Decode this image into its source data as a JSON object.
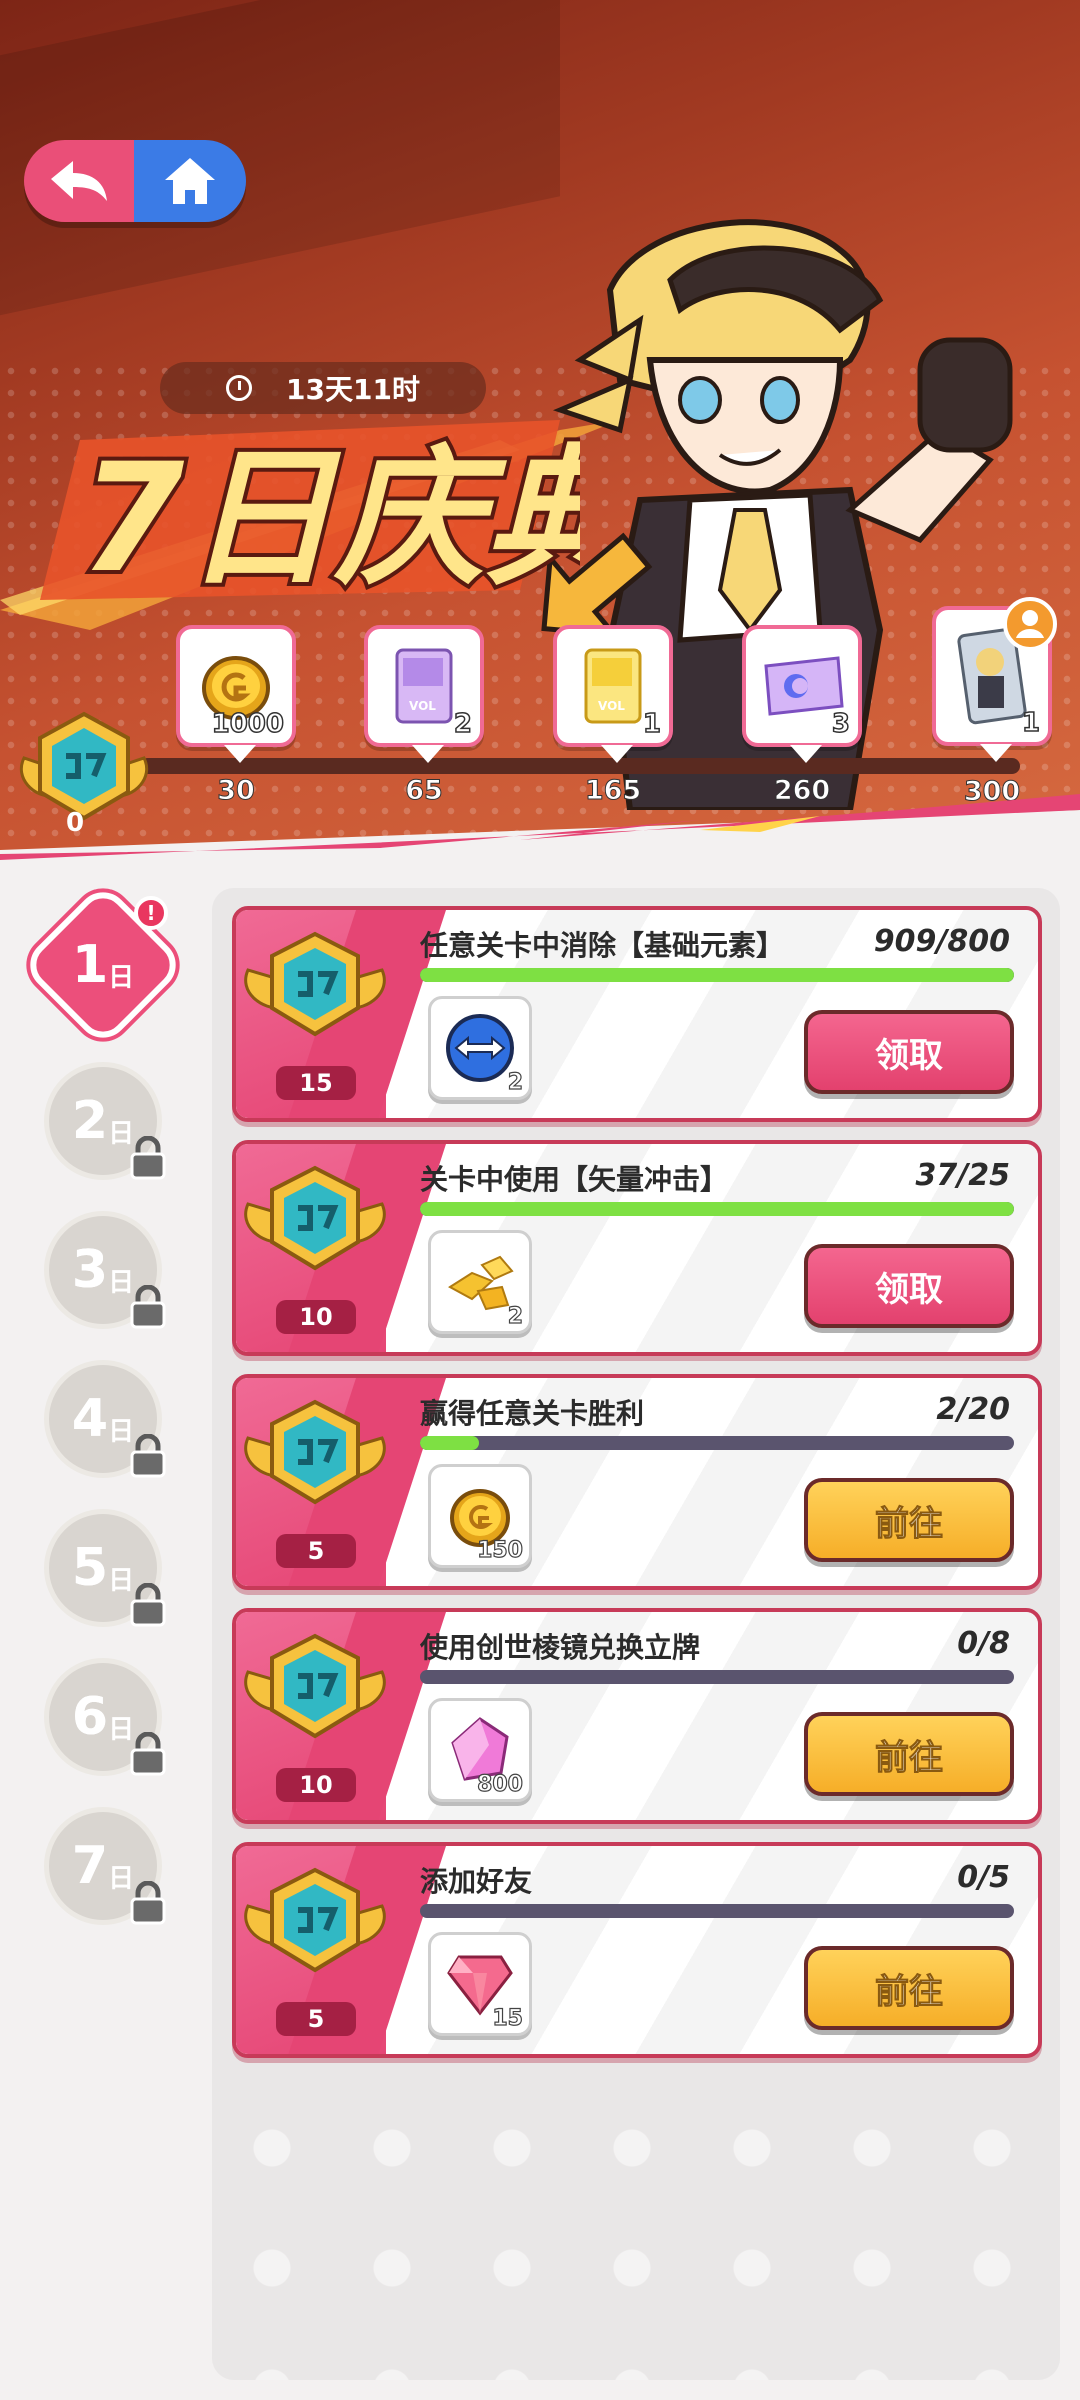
{
  "header": {
    "timer": "13天11时",
    "event_title": "7日庆典",
    "badge_count": "0"
  },
  "milestones": [
    {
      "points": "30",
      "qty": "1000",
      "icon": "gold-coin-icon"
    },
    {
      "points": "65",
      "qty": "2",
      "icon": "purple-card-pack-icon"
    },
    {
      "points": "165",
      "qty": "1",
      "icon": "yellow-card-pack-icon"
    },
    {
      "points": "260",
      "qty": "3",
      "icon": "ticket-icon"
    },
    {
      "points": "300",
      "qty": "1",
      "icon": "character-card-icon"
    }
  ],
  "days": [
    {
      "num": "1",
      "suffix": "日",
      "state": "active",
      "dot": "!"
    },
    {
      "num": "2",
      "suffix": "日",
      "state": "locked"
    },
    {
      "num": "3",
      "suffix": "日",
      "state": "locked"
    },
    {
      "num": "4",
      "suffix": "日",
      "state": "locked"
    },
    {
      "num": "5",
      "suffix": "日",
      "state": "locked"
    },
    {
      "num": "6",
      "suffix": "日",
      "state": "locked"
    },
    {
      "num": "7",
      "suffix": "日",
      "state": "locked"
    }
  ],
  "tasks": [
    {
      "points": "15",
      "title": "任意关卡中消除【基础元素】",
      "progress": "909/800",
      "fill": 1.0,
      "item_qty": "2",
      "item_icon": "swap-arrows-icon",
      "button": "领取",
      "button_type": "claim"
    },
    {
      "points": "10",
      "title": "关卡中使用【矢量冲击】",
      "progress": "37/25",
      "fill": 1.0,
      "item_qty": "2",
      "item_icon": "gold-shards-icon",
      "button": "领取",
      "button_type": "claim"
    },
    {
      "points": "5",
      "title": "赢得任意关卡胜利",
      "progress": "2/20",
      "fill": 0.1,
      "item_qty": "150",
      "item_icon": "gold-coin-icon",
      "button": "前往",
      "button_type": "go"
    },
    {
      "points": "10",
      "title": "使用创世棱镜兑换立牌",
      "progress": "0/8",
      "fill": 0,
      "item_qty": "800",
      "item_icon": "prism-crystal-icon",
      "button": "前往",
      "button_type": "go"
    },
    {
      "points": "5",
      "title": "添加好友",
      "progress": "0/5",
      "fill": 0,
      "item_qty": "15",
      "item_icon": "pink-gem-icon",
      "button": "前往",
      "button_type": "go"
    }
  ],
  "colors": {
    "accent_pink": "#e54574",
    "progress_green": "#7ee043",
    "go_yellow": "#f6ae28"
  }
}
